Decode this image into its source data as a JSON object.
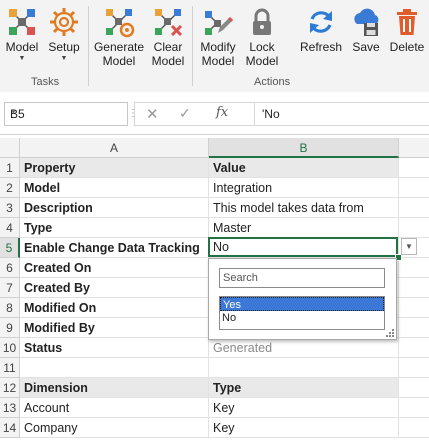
{
  "ribbon": {
    "groups": [
      {
        "label": "Tasks"
      },
      {
        "label": "Actions"
      }
    ],
    "buttons": {
      "model": {
        "label": "Model",
        "icon": "model-icon"
      },
      "setup": {
        "label": "Setup",
        "icon": "gear-icon"
      },
      "generate": {
        "line1": "Generate",
        "line2": "Model",
        "icon": "generate-model-icon"
      },
      "clear": {
        "line1": "Clear",
        "line2": "Model",
        "icon": "clear-model-icon"
      },
      "modify": {
        "line1": "Modify",
        "line2": "Model",
        "icon": "modify-model-icon"
      },
      "lock": {
        "line1": "Lock",
        "line2": "Model",
        "icon": "lock-icon"
      },
      "refresh": {
        "label": "Refresh",
        "icon": "refresh-icon"
      },
      "save": {
        "label": "Save",
        "icon": "cloud-save-icon"
      },
      "delete": {
        "label": "Delete",
        "icon": "trash-icon"
      }
    },
    "accent": "#217346"
  },
  "formula_bar": {
    "name_box": "B5",
    "value": "'No"
  },
  "grid": {
    "columns": [
      "A",
      "B"
    ],
    "rows": [
      {
        "num": "1",
        "a": "Property",
        "b": "Value"
      },
      {
        "num": "2",
        "a": "Model",
        "b": "Integration"
      },
      {
        "num": "3",
        "a": "Description",
        "b": "This model takes data from"
      },
      {
        "num": "4",
        "a": "Type",
        "b": "Master"
      },
      {
        "num": "5",
        "a": "Enable Change Data Tracking",
        "b": "No"
      },
      {
        "num": "6",
        "a": "Created On",
        "b": ""
      },
      {
        "num": "7",
        "a": "Created By",
        "b": ""
      },
      {
        "num": "8",
        "a": "Modified On",
        "b": ""
      },
      {
        "num": "9",
        "a": "Modified By",
        "b": ""
      },
      {
        "num": "10",
        "a": "Status",
        "b": "Generated"
      },
      {
        "num": "11",
        "a": "",
        "b": ""
      },
      {
        "num": "12",
        "a": "Dimension",
        "b": "Type"
      },
      {
        "num": "13",
        "a": "Account",
        "b": "Key"
      },
      {
        "num": "14",
        "a": "Company",
        "b": "Key"
      }
    ]
  },
  "dropdown": {
    "search_placeholder": "Search",
    "options": [
      "Yes",
      "No"
    ],
    "highlighted": "Yes"
  }
}
